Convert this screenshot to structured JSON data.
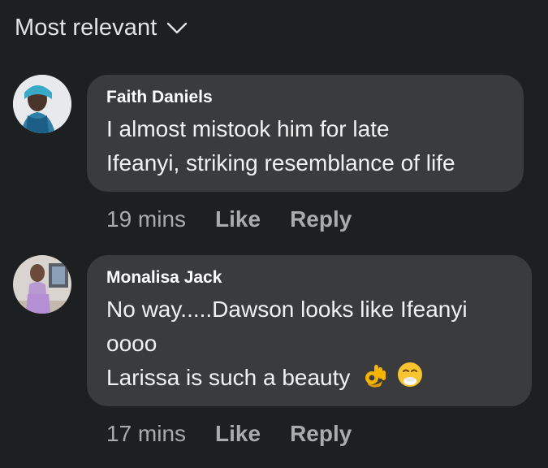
{
  "sort": {
    "label": "Most relevant",
    "icon": "chevron-down-icon"
  },
  "comments": [
    {
      "author": "Faith Daniels",
      "lines": [
        "I almost mistook him for late",
        "Ifeanyi, striking resemblance of life"
      ],
      "time": "19 mins",
      "like_label": "Like",
      "reply_label": "Reply"
    },
    {
      "author": "Monalisa Jack",
      "lines": [
        "No way.....Dawson looks like Ifeanyi",
        "oooo",
        "Larissa is such a beauty"
      ],
      "emojis": [
        "ok-hand-emoji",
        "hand-over-mouth-emoji"
      ],
      "time": "17 mins",
      "like_label": "Like",
      "reply_label": "Reply"
    }
  ],
  "colors": {
    "background": "#1e1f21",
    "bubble": "#3a3b3d",
    "meta_text": "#a9abaf"
  }
}
